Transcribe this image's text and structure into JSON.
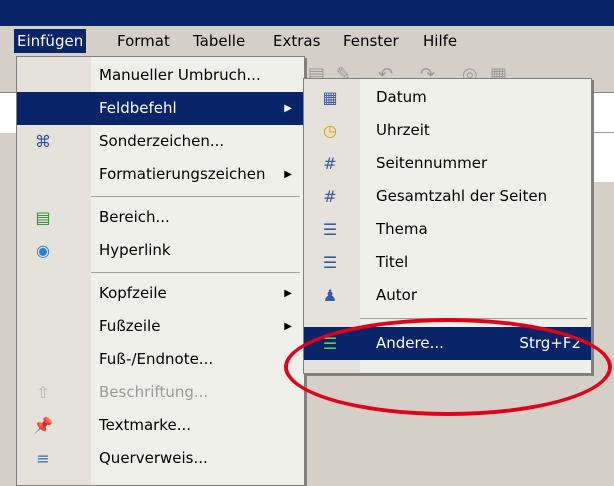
{
  "menubar": {
    "items": [
      {
        "label": "Einfügen",
        "active": true
      },
      {
        "label": "Format"
      },
      {
        "label": "Tabelle"
      },
      {
        "label": "Extras"
      },
      {
        "label": "Fenster"
      },
      {
        "label": "Hilfe"
      }
    ]
  },
  "insert_menu": {
    "items": [
      {
        "label": "Manueller Umbruch..."
      },
      {
        "label": "Feldbefehl",
        "highlighted": true,
        "submenu": true
      },
      {
        "label": "Sonderzeichen...",
        "icon": "special-chars-icon"
      },
      {
        "label": "Formatierungszeichen",
        "submenu": true
      },
      {
        "label": "Bereich...",
        "icon": "section-icon"
      },
      {
        "label": "Hyperlink",
        "icon": "hyperlink-globe-icon"
      },
      {
        "label": "Kopfzeile",
        "submenu": true
      },
      {
        "label": "Fußzeile",
        "submenu": true
      },
      {
        "label": "Fuß-/Endnote..."
      },
      {
        "label": "Beschriftung...",
        "disabled": true,
        "icon": "caption-icon"
      },
      {
        "label": "Textmarke...",
        "icon": "bookmark-pin-icon"
      },
      {
        "label": "Querverweis...",
        "icon": "cross-reference-icon"
      }
    ]
  },
  "field_submenu": {
    "items": [
      {
        "label": "Datum",
        "icon": "calendar-icon"
      },
      {
        "label": "Uhrzeit",
        "icon": "clock-icon"
      },
      {
        "label": "Seitennummer",
        "icon": "page-number-icon"
      },
      {
        "label": "Gesamtzahl der Seiten",
        "icon": "page-count-icon"
      },
      {
        "label": "Thema",
        "icon": "subject-icon"
      },
      {
        "label": "Titel",
        "icon": "title-icon"
      },
      {
        "label": "Autor",
        "icon": "author-icon"
      },
      {
        "label": "Andere...",
        "shortcut": "Strg+F2",
        "highlighted": true,
        "icon": "other-fields-icon"
      }
    ]
  },
  "colors": {
    "highlight": "#0a246a",
    "annotation": "#e0001a",
    "menu_bg": "#f0f0ea"
  }
}
